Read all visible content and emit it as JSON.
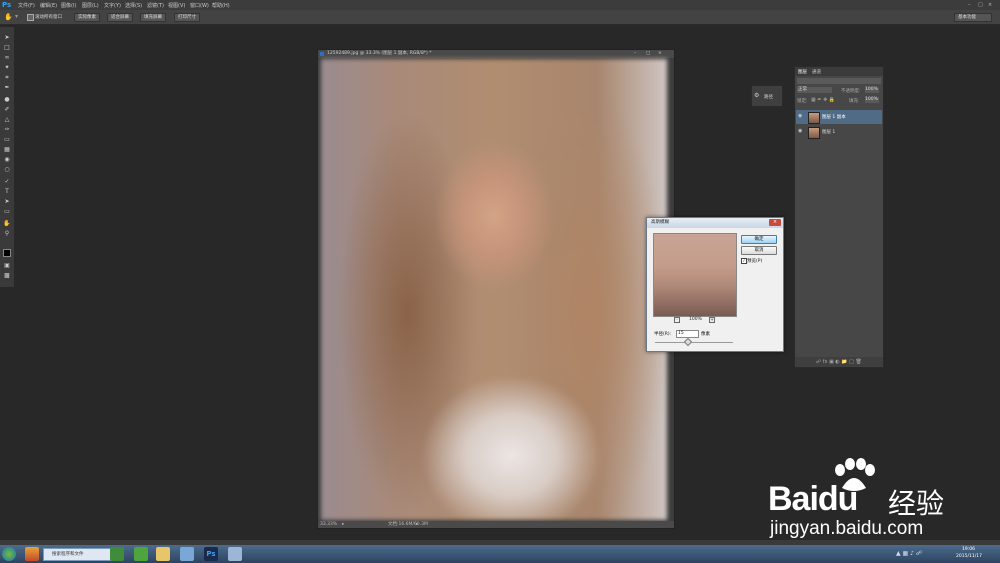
{
  "menu": {
    "logo": "Ps",
    "items": [
      "文件(F)",
      "编辑(E)",
      "图像(I)",
      "图层(L)",
      "文字(Y)",
      "选择(S)",
      "滤镜(T)",
      "视图(V)",
      "窗口(W)",
      "帮助(H)"
    ]
  },
  "options": {
    "checkbox_label": "滚动所有窗口",
    "buttons": [
      "实际像素",
      "适合屏幕",
      "填充屏幕",
      "打印尺寸"
    ],
    "workspace": "基本功能"
  },
  "document": {
    "title": "12592489.jpg @ 33.3% (图层 1 副本, RGB/8*) *",
    "zoom": "33.33%",
    "doc_info": "文档:16.6M/60.3M"
  },
  "mini_panel": {
    "label": "路径"
  },
  "layers_panel": {
    "tabs": [
      "图层",
      "通道"
    ],
    "blend_mode": "正常",
    "opacity_label": "不透明度:",
    "opacity_value": "100%",
    "lock_label": "锁定:",
    "fill_label": "填充:",
    "fill_value": "100%",
    "layers": [
      {
        "name": "图层 1 副本",
        "selected": true
      },
      {
        "name": "图层 1",
        "selected": false
      }
    ]
  },
  "dialog": {
    "title": "高斯模糊",
    "ok": "确定",
    "cancel": "取消",
    "preview_label": "预览(P)",
    "preview_checked": true,
    "zoom_level": "100%",
    "radius_label": "半径(R):",
    "radius_value": "15",
    "radius_unit": "像素"
  },
  "taskbar": {
    "start_label": "",
    "active_item": "搜索程序和文件",
    "time": "19:06",
    "date": "2015/11/17"
  },
  "watermark": {
    "brand": "Baidu",
    "brand_suffix": "经验",
    "url": "jingyan.baidu.com"
  },
  "colors": {
    "accent_ps": "#2fa3f6",
    "panel_bg": "#474747",
    "layer_selected": "#4f6b86",
    "close_red": "#c84a3e"
  }
}
